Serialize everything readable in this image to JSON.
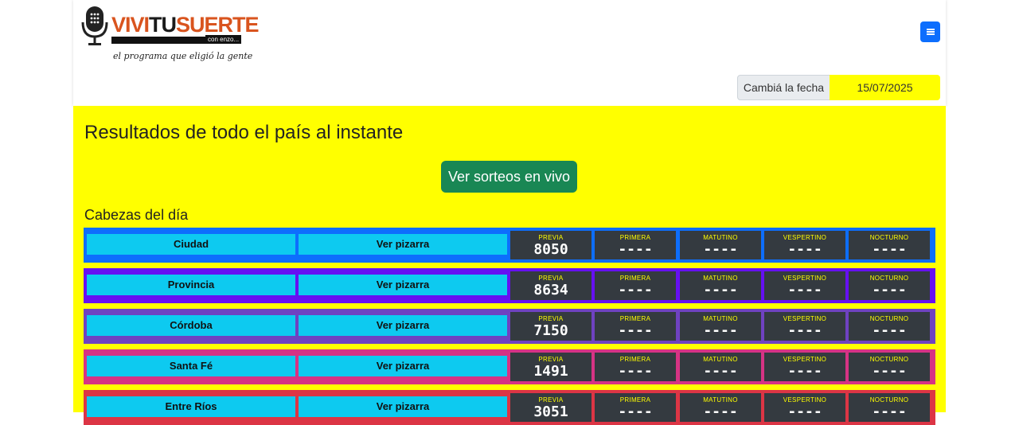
{
  "brand": {
    "left": "VIVI",
    "middle": "TU",
    "right": "SUERTE",
    "sub": "con enzo...",
    "tagline": "el programa que eligió la gente"
  },
  "date_picker": {
    "label": "Cambiá la fecha",
    "value": "15/07/2025"
  },
  "main": {
    "title": "Resultados de todo el país al instante",
    "live_button": "Ver sorteos en vivo",
    "subtitle": "Cabezas del día"
  },
  "draw_labels": [
    "PREVIA",
    "PRIMERA",
    "MATUTINO",
    "VESPERTINO",
    "NOCTURNO"
  ],
  "rows": [
    {
      "name": "Ciudad",
      "board": "Ver pizarra",
      "color": "#0d6efd",
      "values": [
        "8050",
        "----",
        "----",
        "----",
        "----"
      ]
    },
    {
      "name": "Provincia",
      "board": "Ver pizarra",
      "color": "#6610f2",
      "values": [
        "8634",
        "----",
        "----",
        "----",
        "----"
      ]
    },
    {
      "name": "Córdoba",
      "board": "Ver pizarra",
      "color": "#6f42c1",
      "values": [
        "7150",
        "----",
        "----",
        "----",
        "----"
      ]
    },
    {
      "name": "Santa Fé",
      "board": "Ver pizarra",
      "color": "#d63384",
      "values": [
        "1491",
        "----",
        "----",
        "----",
        "----"
      ]
    },
    {
      "name": "Entre Ríos",
      "board": "Ver pizarra",
      "color": "#dc3545",
      "values": [
        "3051",
        "----",
        "----",
        "----",
        "----"
      ]
    }
  ]
}
